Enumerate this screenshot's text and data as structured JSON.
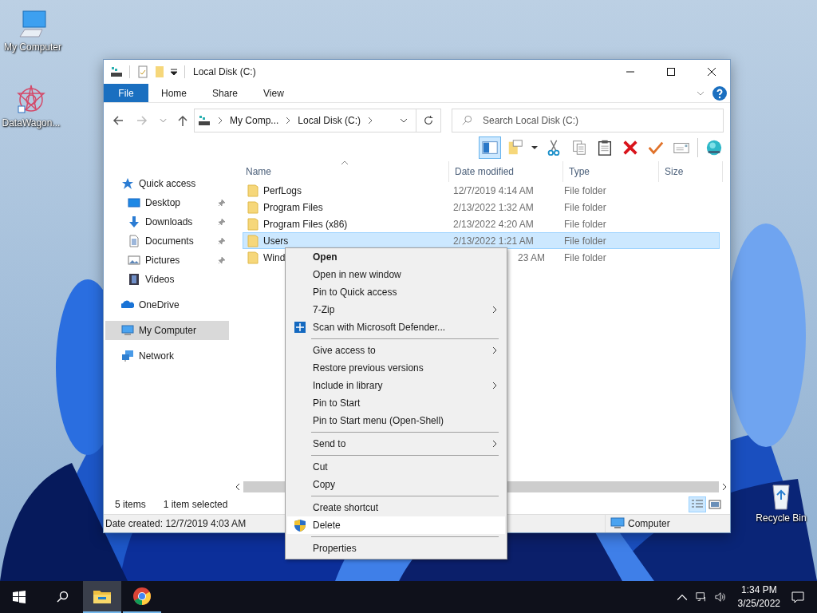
{
  "desktop_icons": [
    {
      "label": "My Computer",
      "kind": "computer"
    },
    {
      "label": "DataWagon...",
      "kind": "app-shortcut"
    },
    {
      "label": "Recycle Bin",
      "kind": "recycle-bin"
    }
  ],
  "window": {
    "title": "Local Disk (C:)"
  },
  "ribbon_tabs": [
    {
      "label": "File",
      "kind": "file"
    },
    {
      "label": "Home",
      "kind": "tab"
    },
    {
      "label": "Share",
      "kind": "tab"
    },
    {
      "label": "View",
      "kind": "tab"
    }
  ],
  "address": {
    "crumbs": [
      "My Comp...",
      "Local Disk (C:)"
    ]
  },
  "search": {
    "placeholder": "Search Local Disk (C:)"
  },
  "layout_pane": {
    "on": true
  },
  "toolbar": [
    {
      "kind": "new-item"
    },
    {
      "kind": "dropdown"
    },
    {
      "kind": "cut"
    },
    {
      "kind": "copy"
    },
    {
      "kind": "paste"
    },
    {
      "kind": "delete"
    },
    {
      "kind": "check"
    },
    {
      "kind": "rename"
    },
    {
      "kind": "globe"
    }
  ],
  "sidebar": [
    {
      "label": "Quick access",
      "kind": "star",
      "selected": false,
      "children": [
        {
          "label": "Desktop",
          "kind": "desktop",
          "selected": false,
          "pinned": true
        },
        {
          "label": "Downloads",
          "kind": "downloads",
          "selected": false,
          "pinned": true
        },
        {
          "label": "Documents",
          "kind": "documents",
          "selected": false,
          "pinned": true
        },
        {
          "label": "Pictures",
          "kind": "pictures",
          "selected": false,
          "pinned": true
        },
        {
          "label": "Videos",
          "kind": "videos",
          "selected": false,
          "pinned": false
        }
      ]
    },
    {
      "label": "OneDrive",
      "kind": "cloud",
      "selected": false
    },
    {
      "label": "My Computer",
      "kind": "computer",
      "selected": true
    },
    {
      "label": "Network",
      "kind": "network",
      "selected": false
    }
  ],
  "columns": [
    {
      "label": "Name",
      "sorted": true
    },
    {
      "label": "Date modified",
      "sorted": false
    },
    {
      "label": "Type",
      "sorted": false
    },
    {
      "label": "Size",
      "sorted": false
    }
  ],
  "files": [
    {
      "name": "PerfLogs",
      "date_modified": "12/7/2019 4:14 AM",
      "type": "File folder",
      "selected": false
    },
    {
      "name": "Program Files",
      "date_modified": "2/13/2022 1:32 AM",
      "type": "File folder",
      "selected": false
    },
    {
      "name": "Program Files (x86)",
      "date_modified": "2/13/2022 4:20 AM",
      "type": "File folder",
      "selected": false
    },
    {
      "name": "Users",
      "date_modified": "2/13/2022 1:21 AM",
      "type": "File folder",
      "selected": true
    },
    {
      "name": "Wind",
      "date_modified": "23 AM",
      "type": "File folder",
      "selected": false,
      "covered": true
    }
  ],
  "status": {
    "count": "5 items",
    "selection": "1 item selected",
    "views": [
      {
        "kind": "details",
        "selected": true
      },
      {
        "kind": "large-icons",
        "selected": false
      }
    ]
  },
  "details_bar": {
    "info": "Date created: 12/7/2019 4:03 AM",
    "location": "Computer"
  },
  "context_menu": [
    {
      "label": "Open",
      "kind": "item",
      "default": true,
      "selected": false
    },
    {
      "label": "Open in new window",
      "kind": "item",
      "selected": false
    },
    {
      "label": "Pin to Quick access",
      "kind": "item",
      "selected": false
    },
    {
      "label": "7-Zip",
      "kind": "submenu",
      "selected": false
    },
    {
      "label": "Scan with Microsoft Defender...",
      "kind": "scan",
      "selected": false
    },
    {
      "kind": "separator"
    },
    {
      "label": "Give access to",
      "kind": "submenu",
      "selected": false
    },
    {
      "label": "Restore previous versions",
      "kind": "item",
      "selected": false
    },
    {
      "label": "Include in library",
      "kind": "submenu",
      "selected": false
    },
    {
      "label": "Pin to Start",
      "kind": "item",
      "selected": false
    },
    {
      "label": "Pin to Start menu (Open-Shell)",
      "kind": "item",
      "selected": false
    },
    {
      "kind": "separator"
    },
    {
      "label": "Send to",
      "kind": "submenu",
      "selected": false
    },
    {
      "kind": "separator"
    },
    {
      "label": "Cut",
      "kind": "item",
      "selected": false
    },
    {
      "label": "Copy",
      "kind": "item",
      "selected": false
    },
    {
      "kind": "separator"
    },
    {
      "label": "Create shortcut",
      "kind": "item",
      "selected": false
    },
    {
      "label": "Delete",
      "kind": "admin",
      "selected": true
    },
    {
      "kind": "separator"
    },
    {
      "label": "Properties",
      "kind": "item",
      "selected": false
    }
  ],
  "taskbar": {
    "apps": [
      {
        "kind": "explorer",
        "active": true
      },
      {
        "kind": "chrome",
        "active": false
      }
    ],
    "time": "1:34 PM",
    "date": "3/25/2022"
  }
}
